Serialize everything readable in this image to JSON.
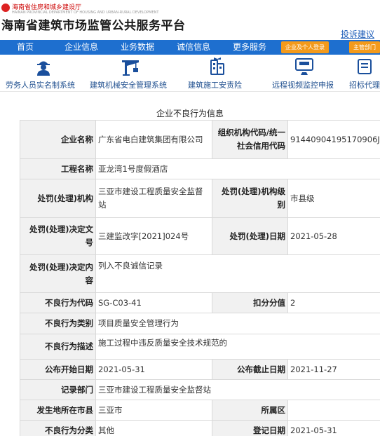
{
  "header": {
    "department": "海南省住房和城乡建设厅",
    "department_en": "HAINAN PROVINCIAL DEPARTMENT OF HOUSING AND URBAN-RURAL DEVELOPMENT",
    "site_title": "海南省建筑市场监管公共服务平台",
    "complaint_link": "投诉建议"
  },
  "nav": {
    "items": [
      "首页",
      "企业信息",
      "业务数据",
      "诚信信息",
      "更多服务"
    ],
    "login_button": "企业及个人登录",
    "admin_button": "主管部门"
  },
  "services": [
    {
      "label": "劳务人员实名制系统",
      "icon": "worker-icon"
    },
    {
      "label": "建筑机械安全管理系统",
      "icon": "crane-icon"
    },
    {
      "label": "建筑施工安责险",
      "icon": "insurance-icon"
    },
    {
      "label": "远程视频监控申报",
      "icon": "video-monitor-icon"
    },
    {
      "label": "招标代理",
      "icon": "bidding-icon"
    }
  ],
  "record": {
    "title": "企业不良行为信息",
    "company_name_label": "企业名称",
    "company_name": "广东省电白建筑集团有限公司",
    "org_code_label": "组织机构代码/统一社会信用代码",
    "org_code": "91440904195170906J",
    "project_label": "工程名称",
    "project": "亚龙湾1号度假酒店",
    "authority_label": "处罚(处理)机构",
    "authority": "三亚市建设工程质量安全监督站",
    "authority_level_label": "处罚(处理)机构级别",
    "authority_level": "市县级",
    "decision_no_label": "处罚(处理)决定文号",
    "decision_no": "三建监改字[2021]024号",
    "decision_date_label": "处罚(处理)日期",
    "decision_date": "2021-05-28",
    "decision_content_label": "处罚(处理)决定内容",
    "decision_content": "列入不良诚信记录",
    "code_label": "不良行为代码",
    "code": "SG-C03-41",
    "points_label": "扣分分值",
    "points": "2",
    "category_label": "不良行为类别",
    "category": "项目质量安全管理行为",
    "description_label": "不良行为描述",
    "description": "施工过程中违反质量安全技术规范的",
    "start_date_label": "公布开始日期",
    "start_date": "2021-05-31",
    "end_date_label": "公布截止日期",
    "end_date": "2021-11-27",
    "record_dept_label": "记录部门",
    "record_dept": "三亚市建设工程质量安全监督站",
    "city_label": "发生地所在市县",
    "city": "三亚市",
    "district_label": "所属区",
    "district": "",
    "class_label": "不良行为分类",
    "class": "其他",
    "register_date_label": "登记日期",
    "register_date": "2021-05-31"
  }
}
